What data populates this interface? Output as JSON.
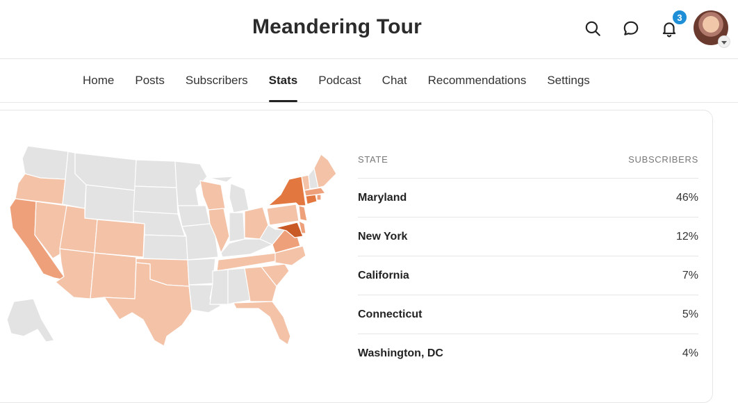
{
  "header": {
    "title": "Meandering Tour",
    "notification_count": "3"
  },
  "nav": {
    "tabs": [
      {
        "label": "Home",
        "active": false
      },
      {
        "label": "Posts",
        "active": false
      },
      {
        "label": "Subscribers",
        "active": false
      },
      {
        "label": "Stats",
        "active": true
      },
      {
        "label": "Podcast",
        "active": false
      },
      {
        "label": "Chat",
        "active": false
      },
      {
        "label": "Recommendations",
        "active": false
      },
      {
        "label": "Settings",
        "active": false
      }
    ]
  },
  "table": {
    "col_state": "STATE",
    "col_subscribers": "SUBSCRIBERS",
    "rows": [
      {
        "state": "Maryland",
        "pct": "46%"
      },
      {
        "state": "New York",
        "pct": "12%"
      },
      {
        "state": "California",
        "pct": "7%"
      },
      {
        "state": "Connecticut",
        "pct": "5%"
      },
      {
        "state": "Washington, DC",
        "pct": "4%"
      }
    ]
  },
  "colors": {
    "unshaded": "#e3e3e3",
    "light": "#f3c2a7",
    "medium": "#eea07a",
    "strong": "#e2773f",
    "darkest": "#c95a25",
    "accent_badge": "#1e8fd6"
  }
}
